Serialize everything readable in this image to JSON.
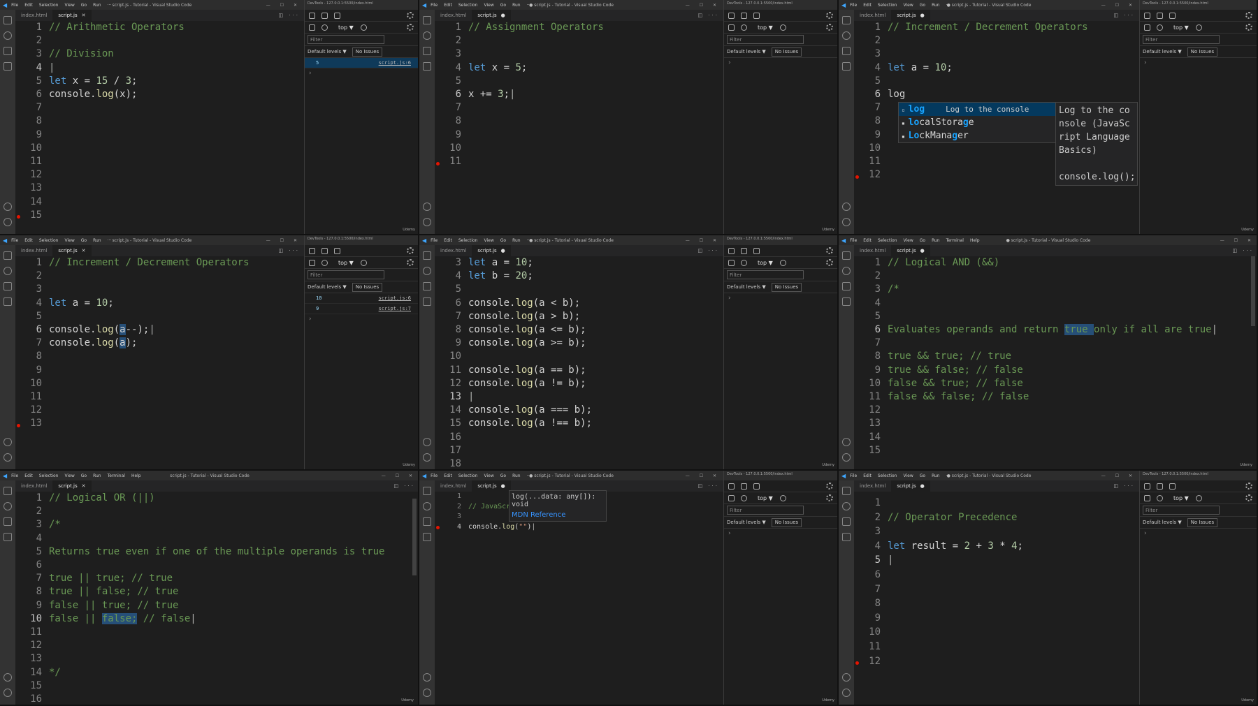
{
  "app": {
    "menu": [
      "File",
      "Edit",
      "Selection",
      "View",
      "Go",
      "Run",
      "···"
    ],
    "menu_ext": [
      "File",
      "Edit",
      "Selection",
      "View",
      "Go",
      "Run",
      "Terminal",
      "Help"
    ],
    "window_controls": "— ☐ ✕",
    "watermark": "Udemy"
  },
  "devtools": {
    "context": "top ▼",
    "filter_placeholder": "Filter",
    "levels": "Default levels ▼",
    "issues": "No Issues",
    "url": "DevTools - 127.0.0.1:5500/index.html"
  },
  "panels": [
    {
      "title": "script.js - Tutorial - Visual Studio Code",
      "tabs": [
        "index.html",
        "script.js"
      ],
      "lines": [
        "// Arithmetic Operators",
        "",
        "// Division",
        "",
        "let x = 15 / 3;",
        "console.log(x);",
        "",
        "",
        "",
        "",
        "",
        "",
        "",
        "",
        ""
      ],
      "console": [
        {
          "value": "5",
          "source": "script.js:6"
        }
      ]
    },
    {
      "title": "● script.js - Tutorial - Visual Studio Code",
      "tabs": [
        "index.html",
        "script.js"
      ],
      "lines": [
        "// Assignment Operators",
        "",
        "",
        "let x = 5;",
        "",
        "x += 3;",
        "",
        "",
        "",
        "",
        ""
      ],
      "console": []
    },
    {
      "title": "● script.js - Tutorial - Visual Studio Code",
      "tabs": [
        "index.html",
        "script.js"
      ],
      "lines": [
        "// Increment / Decrement Operators",
        "",
        "",
        "let a = 10;",
        "",
        "log",
        "",
        "",
        "",
        "",
        "",
        ""
      ],
      "autocomplete": {
        "items": [
          {
            "label": "log",
            "detail": "Log to the console"
          },
          {
            "label": "localStorage",
            "detail": ""
          },
          {
            "label": "LockManager",
            "detail": ""
          }
        ],
        "doc": "Log to the co\nnsole (JavaSc\nript Language\nBasics)\n\nconsole.log();"
      },
      "console": []
    },
    {
      "title": "script.js - Tutorial - Visual Studio Code",
      "tabs": [
        "index.html",
        "script.js"
      ],
      "lines": [
        "// Increment / Decrement Operators",
        "",
        "",
        "let a = 10;",
        "",
        "console.log(a--);",
        "console.log(a);",
        "",
        "",
        "",
        "",
        "",
        ""
      ],
      "console": [
        {
          "value": "10",
          "source": "script.js:6"
        },
        {
          "value": "9",
          "source": "script.js:7"
        }
      ]
    },
    {
      "title": "● script.js - Tutorial - Visual Studio Code",
      "tabs": [
        "index.html",
        "script.js"
      ],
      "first_line": 3,
      "lines": [
        "let a = 10;",
        "let b = 20;",
        "",
        "console.log(a < b);",
        "console.log(a > b);",
        "console.log(a <= b);",
        "console.log(a >= b);",
        "",
        "console.log(a == b);",
        "console.log(a != b);",
        "",
        "console.log(a === b);",
        "console.log(a !== b);",
        "",
        "",
        ""
      ],
      "console": []
    },
    {
      "title": "● script.js - Tutorial - Visual Studio Code",
      "tabs": [
        "index.html",
        "script.js"
      ],
      "lines": [
        "// Logical AND (&&)",
        "",
        "/*",
        "",
        "",
        "Evaluates operands and return true only if all are true",
        "",
        "true && true; // true",
        "true && false; // false",
        "false && true; // false",
        "false && false; // false",
        "",
        "",
        "",
        ""
      ],
      "console": []
    },
    {
      "title": "script.js - Tutorial - Visual Studio Code",
      "tabs": [
        "index.html",
        "script.js"
      ],
      "lines": [
        "// Logical OR (||)",
        "",
        "/*",
        "",
        "Returns true even if one of the multiple operands is true",
        "",
        "true || true; // true",
        "true || false; // true",
        "false || true; // true",
        "false || false; // false",
        "",
        "",
        "",
        "*/",
        "",
        ""
      ],
      "console": []
    },
    {
      "title": "● script.js - Tutorial - Visual Studio Code",
      "tabs": [
        "index.html",
        "script.js"
      ],
      "lines": [
        "",
        "// JavaScript",
        "",
        "console.log(\"\")"
      ],
      "hint": {
        "signature": "log(...data: any[]): void",
        "link": "MDN Reference"
      },
      "console": []
    },
    {
      "title": "● script.js - Tutorial - Visual Studio Code",
      "tabs": [
        "index.html",
        "script.js"
      ],
      "lines": [
        "",
        "// Operator Precedence",
        "",
        "let result = 2 + 3 * 4;",
        "",
        "",
        "",
        "",
        "",
        "",
        "",
        ""
      ],
      "console": []
    }
  ]
}
